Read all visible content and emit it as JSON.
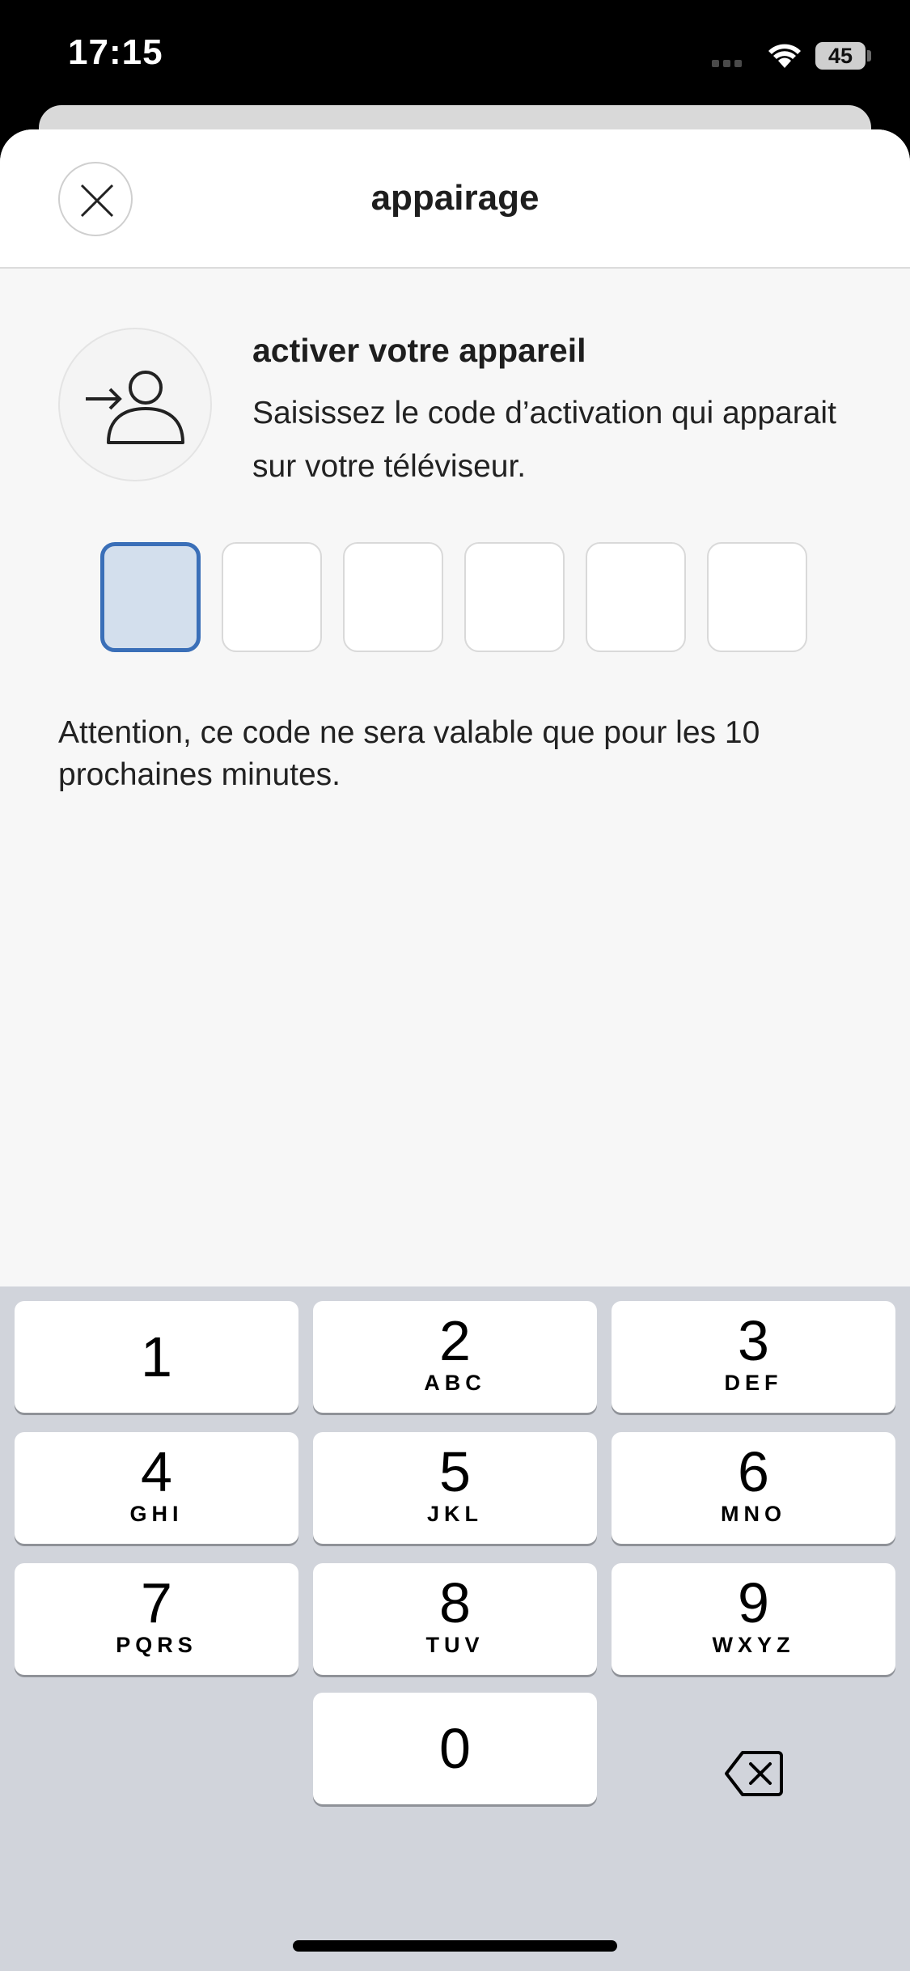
{
  "status_bar": {
    "time": "17:15",
    "battery": "45"
  },
  "header": {
    "title": "appairage"
  },
  "activation": {
    "title": "activer votre appareil",
    "description": "Saisissez le code d’activation qui apparait sur votre téléviseur."
  },
  "code": {
    "length": 6,
    "active_index": 0,
    "values": [
      "",
      "",
      "",
      "",
      "",
      ""
    ]
  },
  "warning": "Attention, ce code ne sera valable que pour les 10 prochaines minutes.",
  "keyboard": {
    "keys": [
      {
        "num": "1",
        "letters": ""
      },
      {
        "num": "2",
        "letters": "ABC"
      },
      {
        "num": "3",
        "letters": "DEF"
      },
      {
        "num": "4",
        "letters": "GHI"
      },
      {
        "num": "5",
        "letters": "JKL"
      },
      {
        "num": "6",
        "letters": "MNO"
      },
      {
        "num": "7",
        "letters": "PQRS"
      },
      {
        "num": "8",
        "letters": "TUV"
      },
      {
        "num": "9",
        "letters": "WXYZ"
      },
      {
        "num": "0",
        "letters": ""
      }
    ]
  },
  "colors": {
    "accent": "#3a6fb8",
    "active_fill": "#d3dfed"
  }
}
